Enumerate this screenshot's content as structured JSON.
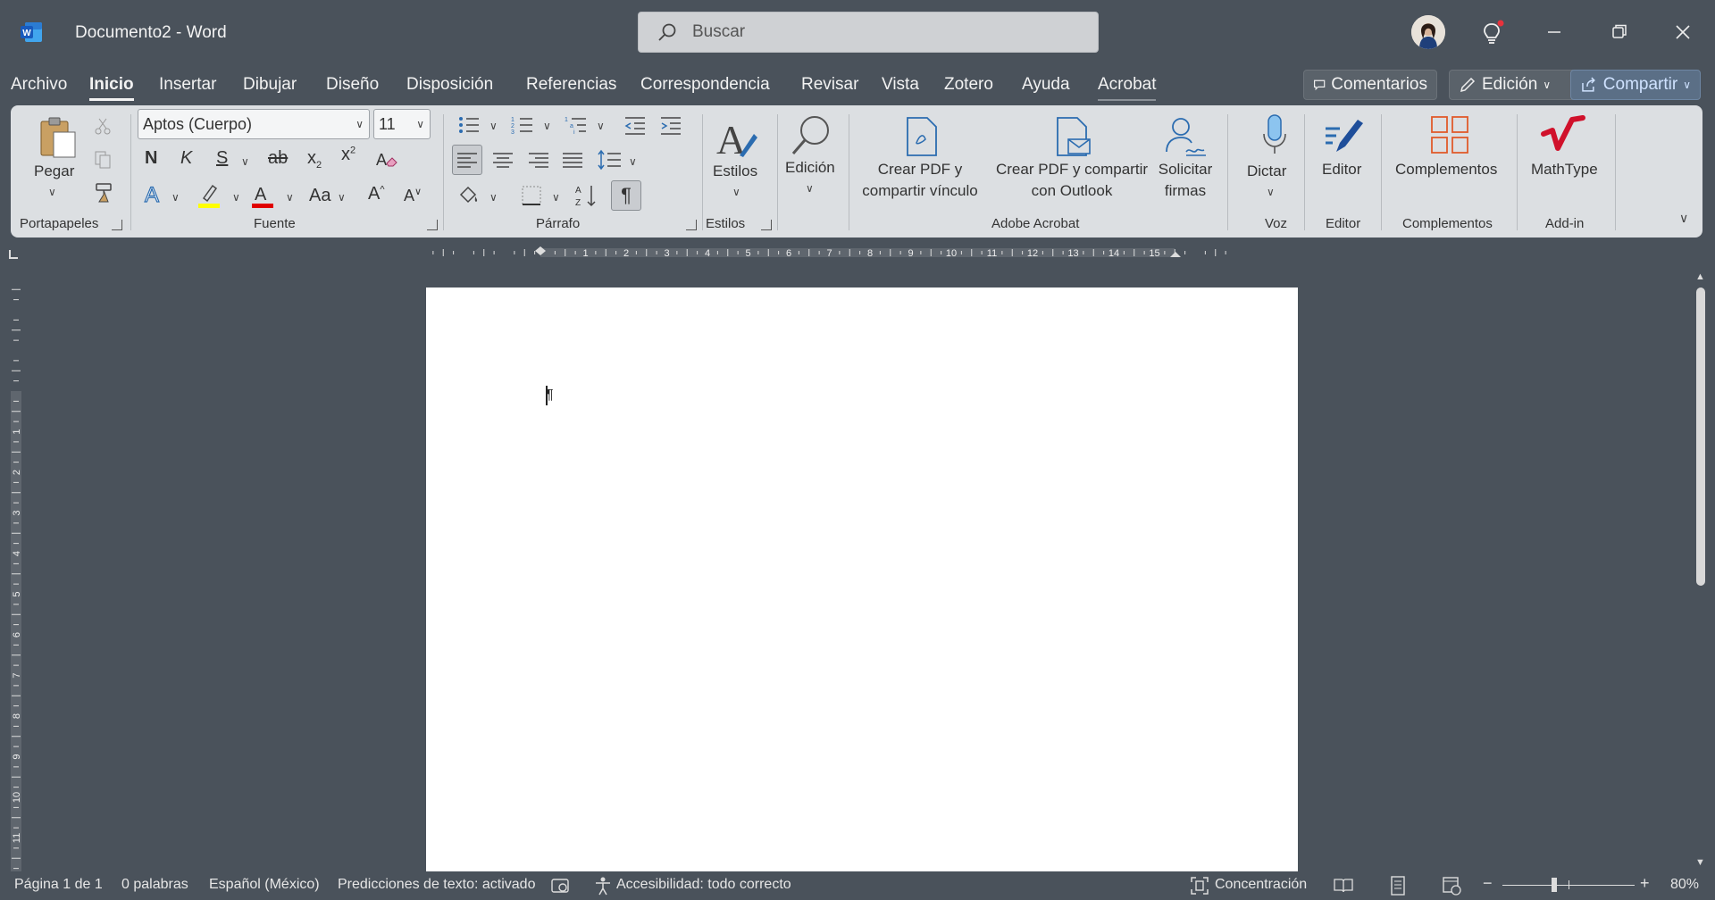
{
  "titlebar": {
    "title": "Documento2  -  Word",
    "search_placeholder": "Buscar"
  },
  "tabs": [
    {
      "label": "Archivo"
    },
    {
      "label": "Inicio"
    },
    {
      "label": "Insertar"
    },
    {
      "label": "Dibujar"
    },
    {
      "label": "Diseño"
    },
    {
      "label": "Disposición"
    },
    {
      "label": "Referencias"
    },
    {
      "label": "Correspondencia"
    },
    {
      "label": "Revisar"
    },
    {
      "label": "Vista"
    },
    {
      "label": "Zotero"
    },
    {
      "label": "Ayuda"
    },
    {
      "label": "Acrobat"
    }
  ],
  "top_buttons": {
    "comments": "Comentarios",
    "editing": "Edición",
    "share": "Compartir"
  },
  "ribbon": {
    "clipboard": {
      "paste": "Pegar",
      "group": "Portapapeles"
    },
    "font": {
      "family": "Aptos (Cuerpo)",
      "size": "11",
      "bold": "N",
      "italic": "K",
      "underline": "S",
      "group": "Fuente"
    },
    "paragraph": {
      "group": "Párrafo"
    },
    "styles": {
      "label": "Estilos",
      "group": "Estilos"
    },
    "editing": {
      "label": "Edición"
    },
    "acrobat": {
      "pdf_share_line1": "Crear PDF y",
      "pdf_share_line2": "compartir vínculo",
      "pdf_outlook_line1": "Crear PDF y compartir",
      "pdf_outlook_line2": "con Outlook",
      "sign_line1": "Solicitar",
      "sign_line2": "firmas",
      "group": "Adobe Acrobat"
    },
    "voice": {
      "label": "Dictar",
      "group": "Voz"
    },
    "editor": {
      "label": "Editor",
      "group": "Editor"
    },
    "addins": {
      "label": "Complementos",
      "group": "Complementos"
    },
    "mathtype": {
      "label": "MathType",
      "group": "Add-in"
    }
  },
  "ruler": {
    "top_numbers": [
      "1",
      "2",
      "3",
      "4",
      "5",
      "6",
      "7",
      "8",
      "9",
      "10",
      "11",
      "12",
      "13",
      "14",
      "15"
    ],
    "left_numbers": [
      "1",
      "2",
      "3",
      "4",
      "5",
      "6",
      "7",
      "8",
      "9",
      "10",
      "11"
    ]
  },
  "document": {
    "paragraph_mark": "¶"
  },
  "status": {
    "page": "Página 1 de 1",
    "words": "0 palabras",
    "language": "Español (México)",
    "predictions": "Predicciones de texto: activado",
    "accessibility": "Accesibilidad: todo correcto",
    "focus": "Concentración",
    "zoom": "80%"
  },
  "colors": {
    "chrome": "#4a525b",
    "ribbon": "#dcdfe2",
    "accent_blue": "#2b6cb0",
    "highlight_yellow": "#ffff00",
    "font_red": "#e00000",
    "mathtype_red": "#d0112b"
  }
}
